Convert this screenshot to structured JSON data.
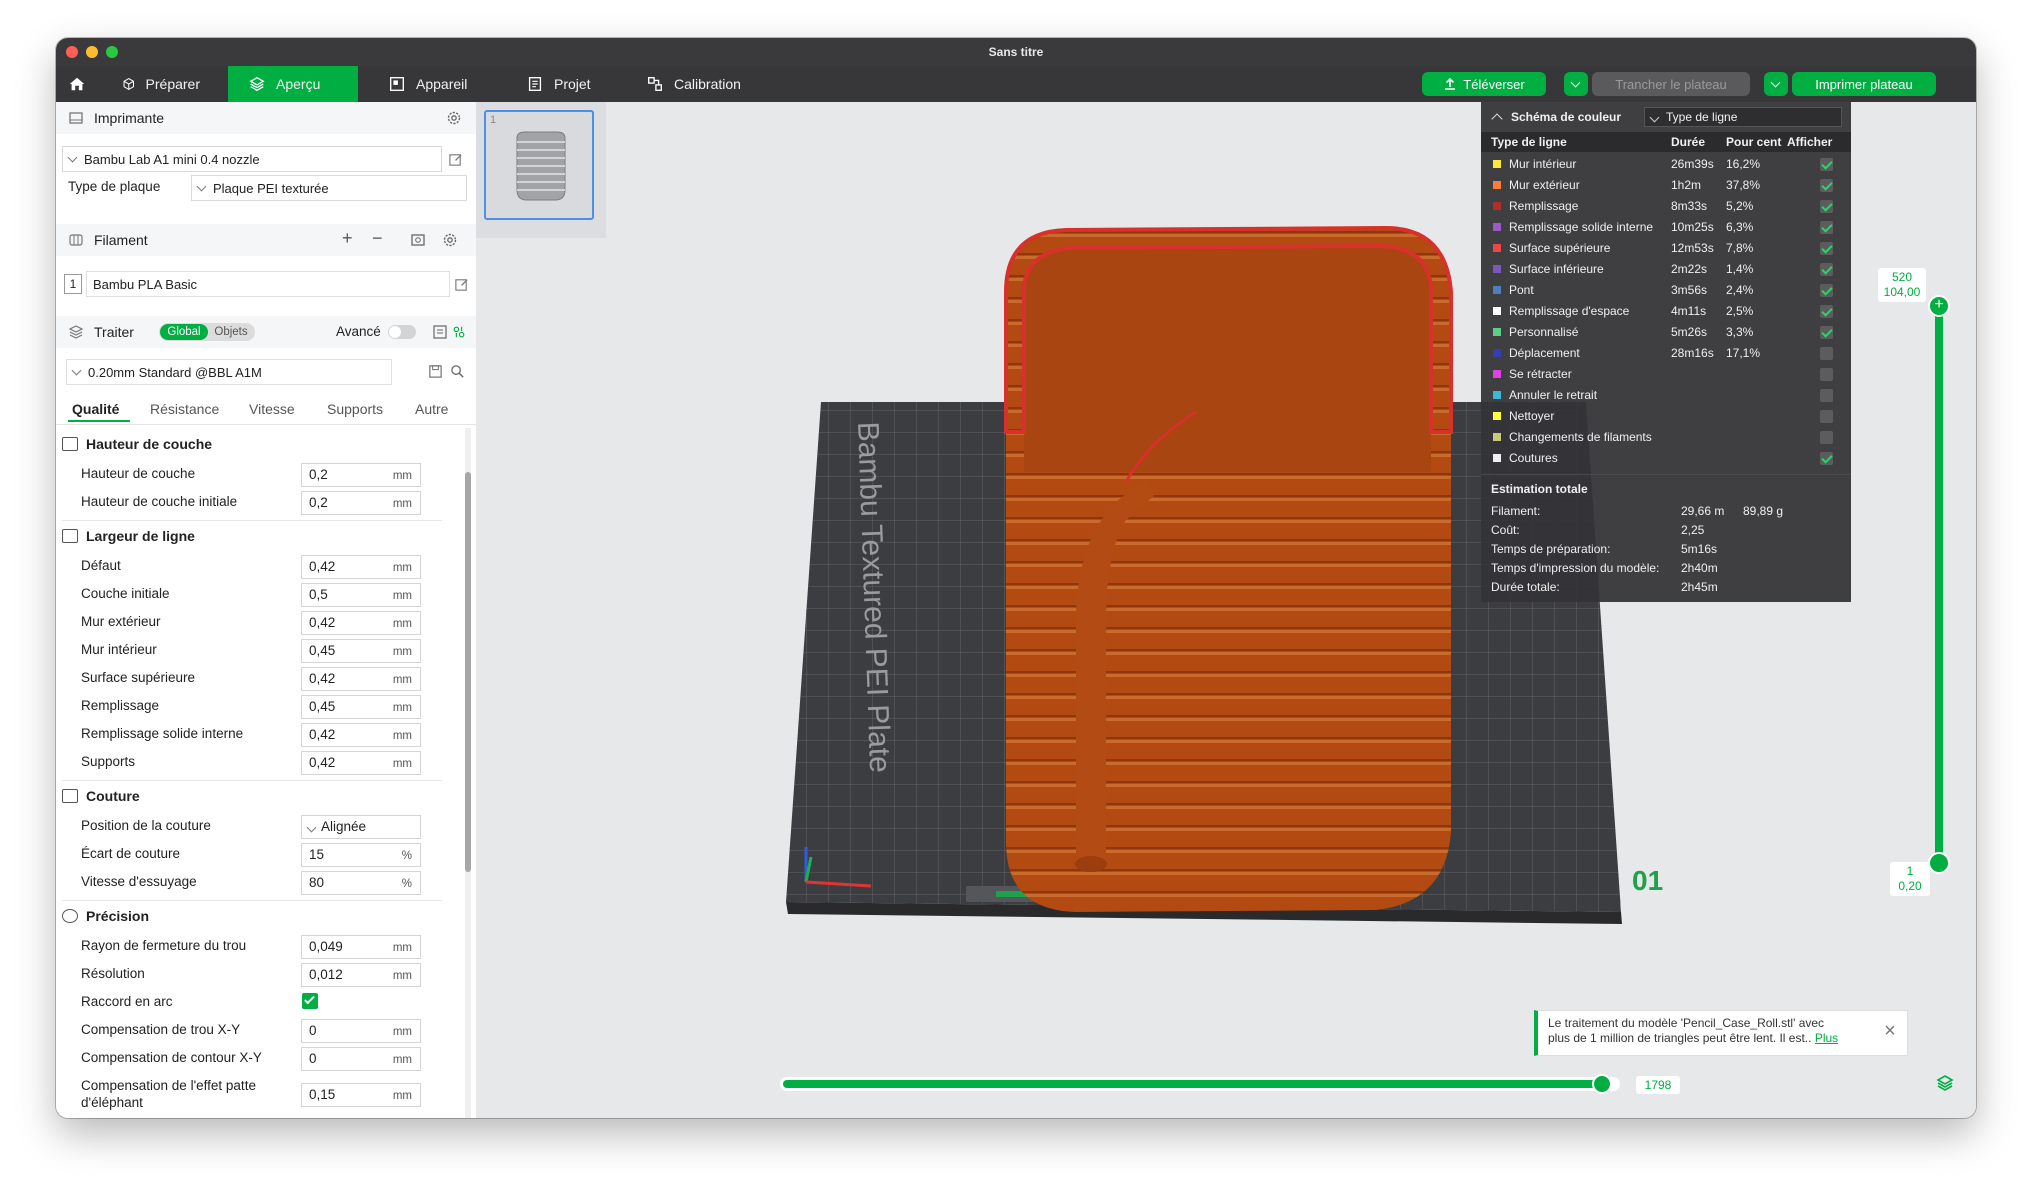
{
  "window": {
    "title": "Sans titre"
  },
  "tabs": [
    {
      "label": "Préparer"
    },
    {
      "label": "Aperçu"
    },
    {
      "label": "Appareil"
    },
    {
      "label": "Projet"
    },
    {
      "label": "Calibration"
    }
  ],
  "actions": {
    "upload": "Téléverser",
    "slice": "Trancher le plateau",
    "print": "Imprimer plateau"
  },
  "printer": {
    "section": "Imprimante",
    "name": "Bambu Lab A1 mini 0.4 nozzle",
    "plate_label": "Type de plaque",
    "plate_value": "Plaque PEI texturée"
  },
  "filament": {
    "section": "Filament",
    "slot": "1",
    "name": "Bambu PLA Basic"
  },
  "process": {
    "section": "Traiter",
    "toggle_global": "Global",
    "toggle_objects": "Objets",
    "advanced": "Avancé",
    "profile": "0.20mm Standard @BBL A1M",
    "subtabs": [
      "Qualité",
      "Résistance",
      "Vitesse",
      "Supports",
      "Autre"
    ]
  },
  "settings": {
    "layer_height": {
      "title": "Hauteur de couche",
      "rows": [
        {
          "label": "Hauteur de couche",
          "value": "0,2",
          "unit": "mm"
        },
        {
          "label": "Hauteur de couche initiale",
          "value": "0,2",
          "unit": "mm"
        }
      ]
    },
    "line_width": {
      "title": "Largeur de ligne",
      "rows": [
        {
          "label": "Défaut",
          "value": "0,42",
          "unit": "mm"
        },
        {
          "label": "Couche initiale",
          "value": "0,5",
          "unit": "mm"
        },
        {
          "label": "Mur extérieur",
          "value": "0,42",
          "unit": "mm"
        },
        {
          "label": "Mur intérieur",
          "value": "0,45",
          "unit": "mm"
        },
        {
          "label": "Surface supérieure",
          "value": "0,42",
          "unit": "mm"
        },
        {
          "label": "Remplissage",
          "value": "0,45",
          "unit": "mm"
        },
        {
          "label": "Remplissage solide interne",
          "value": "0,42",
          "unit": "mm"
        },
        {
          "label": "Supports",
          "value": "0,42",
          "unit": "mm"
        }
      ]
    },
    "seam": {
      "title": "Couture",
      "rows": [
        {
          "label": "Position de la couture",
          "value": "Alignée",
          "unit": ""
        },
        {
          "label": "Écart de couture",
          "value": "15",
          "unit": "%"
        },
        {
          "label": "Vitesse d'essuyage",
          "value": "80",
          "unit": "%"
        }
      ]
    },
    "precision": {
      "title": "Précision",
      "rows": [
        {
          "label": "Rayon de fermeture du trou",
          "value": "0,049",
          "unit": "mm"
        },
        {
          "label": "Résolution",
          "value": "0,012",
          "unit": "mm"
        },
        {
          "label": "Raccord en arc",
          "value": "",
          "unit": ""
        },
        {
          "label": "Compensation de trou X-Y",
          "value": "0",
          "unit": "mm"
        },
        {
          "label": "Compensation de contour X-Y",
          "value": "0",
          "unit": "mm"
        },
        {
          "label": "Compensation de l'effet patte",
          "label2": "d'éléphant",
          "value": "0,15",
          "unit": "mm"
        }
      ]
    }
  },
  "viewport": {
    "plate_text": "Bambu Textured PEI Plate",
    "plate_number": "01",
    "thumb_index": "1",
    "layer_top": "520",
    "layer_top_height": "104,00",
    "layer_bottom": "1",
    "layer_bottom_height": "0,20",
    "move_value": "1798",
    "move_fraction": 0.99,
    "object_color": "#b24a12"
  },
  "legend": {
    "title": "Schéma de couleur",
    "mode": "Type de ligne",
    "col_type": "Type de ligne",
    "col_time": "Durée",
    "col_pct": "Pour cent",
    "col_show": "Afficher",
    "rows": [
      {
        "name": "Mur intérieur",
        "time": "26m39s",
        "pct": "16,2%",
        "color": "#ffe93b",
        "show": true
      },
      {
        "name": "Mur extérieur",
        "time": "1h2m",
        "pct": "37,8%",
        "color": "#ff7d38",
        "show": true
      },
      {
        "name": "Remplissage",
        "time": "8m33s",
        "pct": "5,2%",
        "color": "#b03029",
        "show": true
      },
      {
        "name": "Remplissage solide interne",
        "time": "10m25s",
        "pct": "6,3%",
        "color": "#9a5bc6",
        "show": true
      },
      {
        "name": "Surface supérieure",
        "time": "12m53s",
        "pct": "7,8%",
        "color": "#f04545",
        "show": true
      },
      {
        "name": "Surface inférieure",
        "time": "2m22s",
        "pct": "1,4%",
        "color": "#7a59b8",
        "show": true
      },
      {
        "name": "Pont",
        "time": "3m56s",
        "pct": "2,4%",
        "color": "#4d80ba",
        "show": true
      },
      {
        "name": "Remplissage d'espace",
        "time": "4m11s",
        "pct": "2,5%",
        "color": "#ffffff",
        "show": true
      },
      {
        "name": "Personnalisé",
        "time": "5m26s",
        "pct": "3,3%",
        "color": "#5ecf88",
        "show": true
      },
      {
        "name": "Déplacement",
        "time": "28m16s",
        "pct": "17,1%",
        "color": "#3040b0",
        "show": false
      },
      {
        "name": "Se rétracter",
        "time": "",
        "pct": "",
        "color": "#e040e8",
        "show": false
      },
      {
        "name": "Annuler le retrait",
        "time": "",
        "pct": "",
        "color": "#3fb5d8",
        "show": false
      },
      {
        "name": "Nettoyer",
        "time": "",
        "pct": "",
        "color": "#ffff3a",
        "show": false
      },
      {
        "name": "Changements de filaments",
        "time": "",
        "pct": "",
        "color": "#c9c977",
        "show": false
      },
      {
        "name": "Coutures",
        "time": "",
        "pct": "",
        "color": "#f0f0f0",
        "show": true
      }
    ],
    "estimate_title": "Estimation totale",
    "estimates": [
      {
        "label": "Filament:",
        "value": "29,66 m",
        "value2": "89,89 g"
      },
      {
        "label": "Coût:",
        "value": "2,25",
        "value2": ""
      },
      {
        "label": "Temps de préparation:",
        "value": "5m16s",
        "value2": ""
      },
      {
        "label": "Temps d'impression du modèle:",
        "value": "2h40m",
        "value2": ""
      },
      {
        "label": "Durée totale:",
        "value": "2h45m",
        "value2": ""
      }
    ]
  },
  "notification": {
    "text1": "Le traitement du modèle 'Pencil_Case_Roll.stl' avec",
    "text2": "plus de 1 million de triangles peut être lent. Il est..",
    "link": "Plus"
  },
  "colors": {
    "accent": "#00ae42",
    "toolbar": "#37373a",
    "legend_bg": "#343437"
  }
}
